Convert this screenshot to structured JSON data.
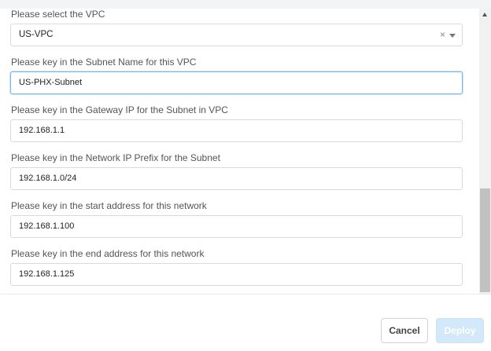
{
  "form": {
    "vpc": {
      "label": "Please select the VPC",
      "value": "US-VPC",
      "clear_glyph": "×"
    },
    "subnet_name": {
      "label": "Please key in the Subnet Name for this VPC",
      "value": "US-PHX-Subnet"
    },
    "gateway_ip": {
      "label": "Please key in the Gateway IP for the Subnet in VPC",
      "value": "192.168.1.1"
    },
    "network_prefix": {
      "label": "Please key in the Network IP Prefix for the Subnet",
      "value": "192.168.1.0/24"
    },
    "start_address": {
      "label": "Please key in the start address for this network",
      "value": "192.168.1.100"
    },
    "end_address": {
      "label": "Please key in the end address for this network",
      "value": "192.168.1.125"
    }
  },
  "footer": {
    "cancel_label": "Cancel",
    "deploy_label": "Deploy"
  },
  "colors": {
    "focus_border": "#7fb6e8",
    "deploy_disabled_bg": "#d3e8f8"
  },
  "icons": {
    "clear": "close-icon",
    "dropdown": "chevron-down-icon",
    "scroll_up": "arrow-up-icon"
  }
}
